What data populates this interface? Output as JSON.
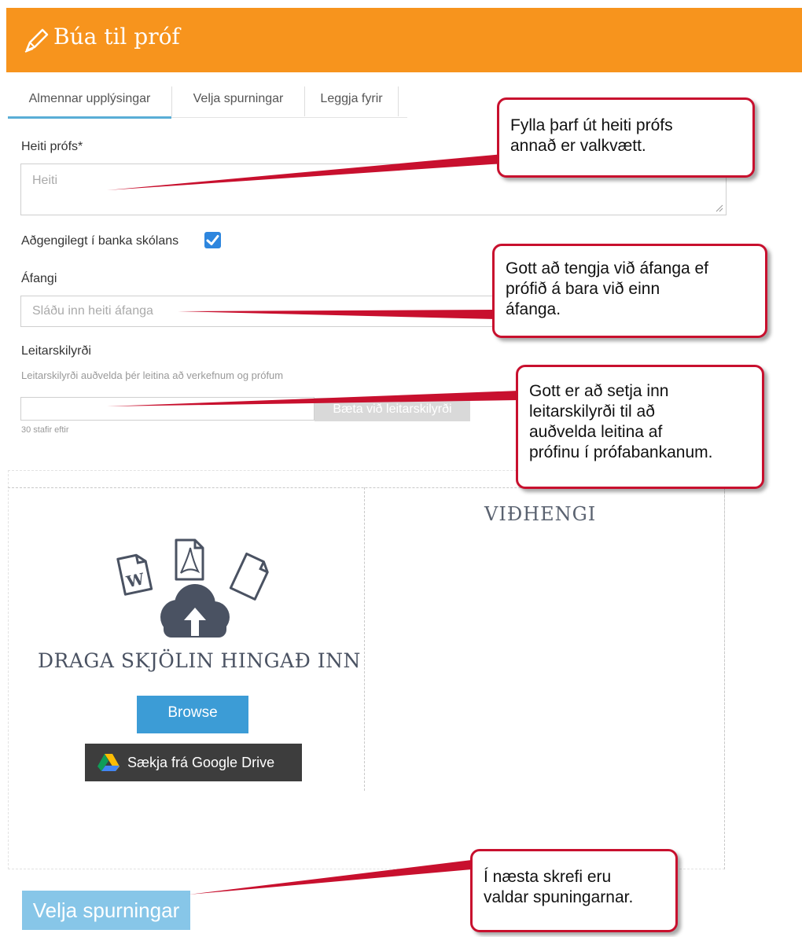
{
  "header": {
    "title": "Búa til próf"
  },
  "tabs": [
    {
      "label": "Almennar upplýsingar"
    },
    {
      "label": "Velja spurningar"
    },
    {
      "label": "Leggja fyrir"
    }
  ],
  "form": {
    "name_label": "Heiti prófs*",
    "name_placeholder": "Heiti",
    "bank_label": "Aðgengilegt í banka skólans",
    "bank_checked": true,
    "course_label": "Áfangi",
    "course_placeholder": "Sláðu inn heiti áfanga",
    "tags_label": "Leitarskilyrði",
    "tags_helper": "Leitarskilyrði auðvelda þér leitina að verkefnum og prófum",
    "tags_value": "",
    "add_tag_button": "Bæta við leitarskilyrði",
    "chars_left": "30 stafir eftir"
  },
  "upload": {
    "drop_title": "DRAGA SKJÖLIN HINGAÐ INN",
    "browse_button": "Browse",
    "gdrive_button": "Sækja frá Google Drive",
    "attachments_title": "VIÐHENGI"
  },
  "next_button": "Velja spurningar",
  "callouts": [
    {
      "lines": [
        "Fylla þarf út heiti prófs",
        "annað er valkvætt."
      ]
    },
    {
      "lines": [
        "Gott að tengja við áfanga ef",
        "prófið á bara við einn",
        "áfanga."
      ]
    },
    {
      "lines": [
        "Gott er að setja inn",
        "leitarskilyrði til að",
        "auðvelda leitina af",
        "prófinu í prófabankanum."
      ]
    },
    {
      "lines": [
        "Í næsta skrefi eru",
        "valdar spuningarnar."
      ]
    }
  ],
  "colors": {
    "header": "#f7941d",
    "accent": "#3c9cd6",
    "callout_border": "#c8102e",
    "checkbox": "#2e86de",
    "next_button": "#87c6e8"
  },
  "icons": [
    "pencil-icon",
    "checkmark-icon",
    "word-file-icon",
    "pdf-file-icon",
    "blank-file-icon",
    "cloud-upload-icon",
    "google-drive-icon"
  ]
}
